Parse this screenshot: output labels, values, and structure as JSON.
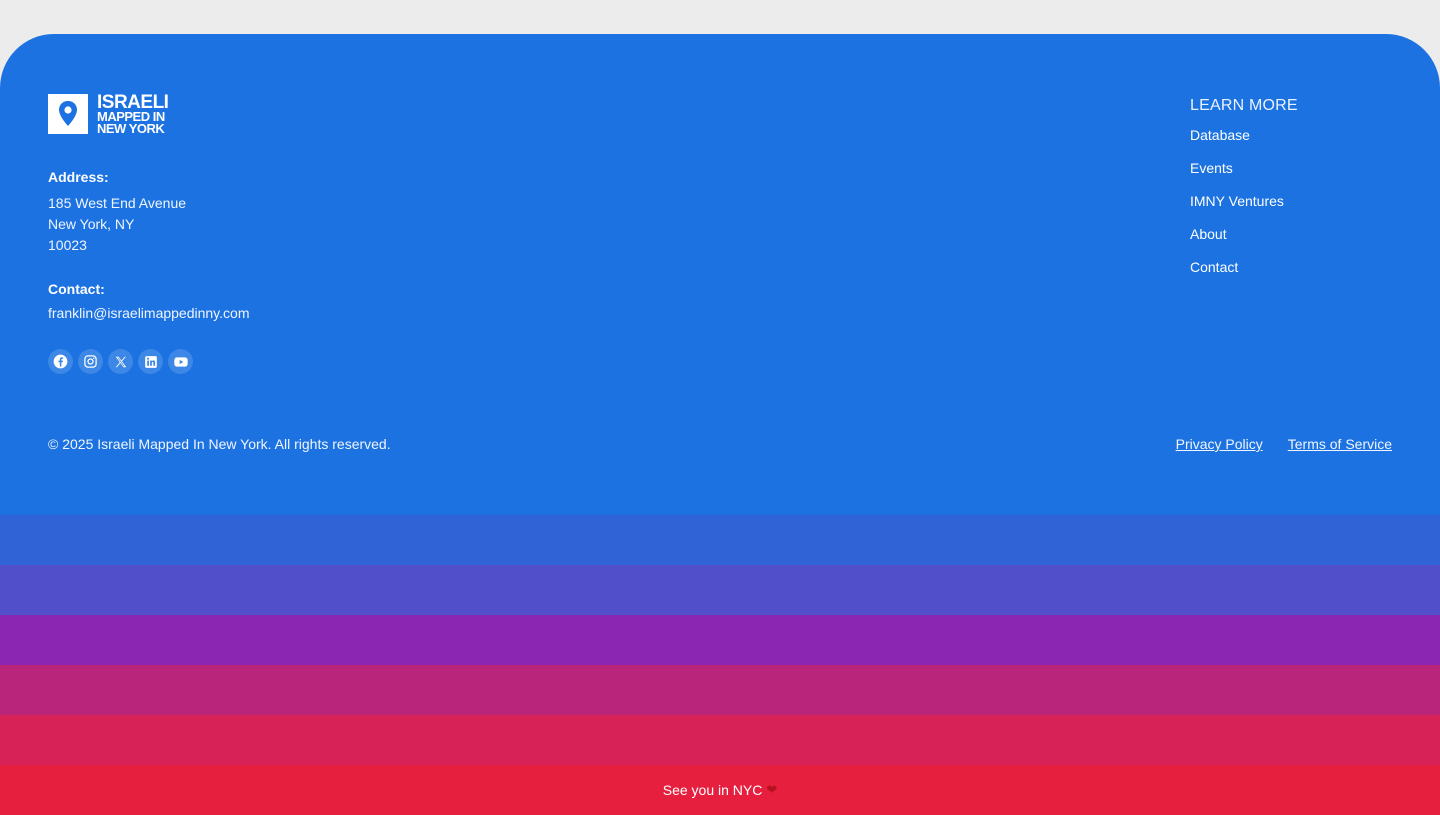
{
  "brand": {
    "logo_line1": "ISRAELI",
    "logo_line2": "MAPPED IN",
    "logo_line3": "NEW YORK",
    "logo_icon": "map-pin-icon",
    "color": "#1b72e0"
  },
  "address": {
    "label": "Address:",
    "line1": "185 West End Avenue",
    "line2": "New York, NY",
    "line3": "10023"
  },
  "contact": {
    "label": "Contact:",
    "email": "franklin@israelimappedinny.com"
  },
  "socials": [
    {
      "name": "facebook-icon"
    },
    {
      "name": "instagram-icon"
    },
    {
      "name": "x-icon"
    },
    {
      "name": "linkedin-icon"
    },
    {
      "name": "youtube-icon"
    }
  ],
  "learn_more": {
    "title": "LEARN MORE",
    "links": [
      "Database",
      "Events",
      "IMNY Ventures",
      "About",
      "Contact"
    ]
  },
  "copyright": "© 2025 Israeli Mapped In New York. All rights reserved.",
  "legal": {
    "privacy": "Privacy Policy",
    "terms": "Terms of Service"
  },
  "bands": {
    "colors": [
      "#2f63d6",
      "#514fca",
      "#8a26b2",
      "#b9257a",
      "#d62257",
      "#e61f3f"
    ]
  },
  "tagline": "See you in NYC",
  "tagline_emoji": "❤"
}
